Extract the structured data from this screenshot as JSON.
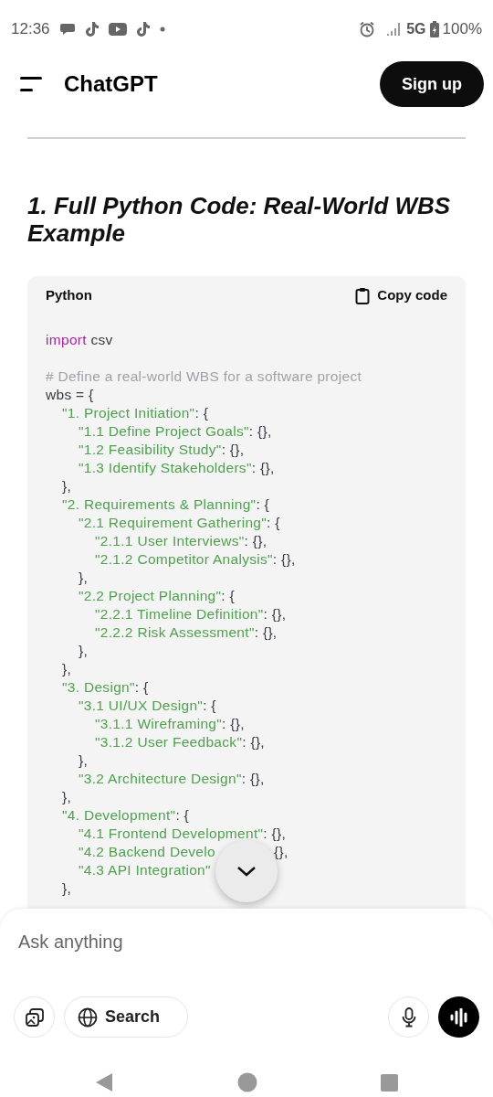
{
  "status_bar": {
    "time": "12:36",
    "network": "5G",
    "battery": "100%"
  },
  "header": {
    "title": "ChatGPT",
    "signup": "Sign up"
  },
  "heading": "1. Full Python Code: Real-World WBS Example",
  "code_block": {
    "language": "Python",
    "copy": "Copy code",
    "lines": [
      {
        "segments": [
          {
            "kind": "keyword",
            "text": "import"
          },
          {
            "kind": "plain",
            "text": " csv"
          }
        ]
      },
      {
        "gap_before": true,
        "segments": [
          {
            "kind": "comment",
            "text": "# Define a real-world WBS for a software project"
          }
        ]
      },
      {
        "segments": [
          {
            "kind": "plain",
            "text": "wbs = {"
          }
        ],
        "children": [
          {
            "segments": [
              {
                "kind": "string",
                "text": "\"1. Project Initiation\""
              },
              {
                "kind": "plain",
                "text": ": {"
              }
            ],
            "children": [
              {
                "segments": [
                  {
                    "kind": "string",
                    "text": "\"1.1 Define Project Goals\""
                  },
                  {
                    "kind": "plain",
                    "text": ": {},"
                  }
                ]
              },
              {
                "segments": [
                  {
                    "kind": "string",
                    "text": "\"1.2 Feasibility Study\""
                  },
                  {
                    "kind": "plain",
                    "text": ": {},"
                  }
                ]
              },
              {
                "segments": [
                  {
                    "kind": "string",
                    "text": "\"1.3 Identify Stakeholders\""
                  },
                  {
                    "kind": "plain",
                    "text": ": {},"
                  }
                ]
              }
            ]
          },
          {
            "segments": [
              {
                "kind": "plain",
                "text": "},"
              }
            ]
          },
          {
            "segments": [
              {
                "kind": "string",
                "text": "\"2. Requirements & Planning\""
              },
              {
                "kind": "plain",
                "text": ": {"
              }
            ],
            "children": [
              {
                "segments": [
                  {
                    "kind": "string",
                    "text": "\"2.1 Requirement Gathering\""
                  },
                  {
                    "kind": "plain",
                    "text": ": {"
                  }
                ],
                "children": [
                  {
                    "segments": [
                      {
                        "kind": "string",
                        "text": "\"2.1.1 User Interviews\""
                      },
                      {
                        "kind": "plain",
                        "text": ": {},"
                      }
                    ]
                  },
                  {
                    "segments": [
                      {
                        "kind": "string",
                        "text": "\"2.1.2 Competitor Analysis\""
                      },
                      {
                        "kind": "plain",
                        "text": ": {},"
                      }
                    ]
                  }
                ]
              },
              {
                "segments": [
                  {
                    "kind": "plain",
                    "text": "},"
                  }
                ]
              },
              {
                "segments": [
                  {
                    "kind": "string",
                    "text": "\"2.2 Project Planning\""
                  },
                  {
                    "kind": "plain",
                    "text": ": {"
                  }
                ],
                "children": [
                  {
                    "segments": [
                      {
                        "kind": "string",
                        "text": "\"2.2.1 Timeline Definition\""
                      },
                      {
                        "kind": "plain",
                        "text": ": {},"
                      }
                    ]
                  },
                  {
                    "segments": [
                      {
                        "kind": "string",
                        "text": "\"2.2.2 Risk Assessment\""
                      },
                      {
                        "kind": "plain",
                        "text": ": {},"
                      }
                    ]
                  }
                ]
              },
              {
                "segments": [
                  {
                    "kind": "plain",
                    "text": "},"
                  }
                ]
              }
            ]
          },
          {
            "segments": [
              {
                "kind": "plain",
                "text": "},"
              }
            ]
          },
          {
            "segments": [
              {
                "kind": "string",
                "text": "\"3. Design\""
              },
              {
                "kind": "plain",
                "text": ": {"
              }
            ],
            "children": [
              {
                "segments": [
                  {
                    "kind": "string",
                    "text": "\"3.1 UI/UX Design\""
                  },
                  {
                    "kind": "plain",
                    "text": ": {"
                  }
                ],
                "children": [
                  {
                    "segments": [
                      {
                        "kind": "string",
                        "text": "\"3.1.1 Wireframing\""
                      },
                      {
                        "kind": "plain",
                        "text": ": {},"
                      }
                    ]
                  },
                  {
                    "segments": [
                      {
                        "kind": "string",
                        "text": "\"3.1.2 User Feedback\""
                      },
                      {
                        "kind": "plain",
                        "text": ": {},"
                      }
                    ]
                  }
                ]
              },
              {
                "segments": [
                  {
                    "kind": "plain",
                    "text": "},"
                  }
                ]
              },
              {
                "segments": [
                  {
                    "kind": "string",
                    "text": "\"3.2 Architecture Design\""
                  },
                  {
                    "kind": "plain",
                    "text": ": {},"
                  }
                ]
              }
            ]
          },
          {
            "segments": [
              {
                "kind": "plain",
                "text": "},"
              }
            ]
          },
          {
            "segments": [
              {
                "kind": "string",
                "text": "\"4. Development\""
              },
              {
                "kind": "plain",
                "text": ": {"
              }
            ],
            "children": [
              {
                "segments": [
                  {
                    "kind": "string",
                    "text": "\"4.1 Frontend Development\""
                  },
                  {
                    "kind": "plain",
                    "text": ": {},"
                  }
                ]
              },
              {
                "segments": [
                  {
                    "kind": "string",
                    "text": "\"4.2 Backend Develo"
                  },
                  {
                    "kind": "tail",
                    "text": "{},"
                  }
                ]
              },
              {
                "segments": [
                  {
                    "kind": "string",
                    "text": "\"4.3 API Integration\""
                  }
                ]
              }
            ]
          },
          {
            "segments": [
              {
                "kind": "plain",
                "text": "},"
              }
            ]
          }
        ]
      }
    ]
  },
  "composer": {
    "placeholder": "Ask anything",
    "search": "Search"
  }
}
